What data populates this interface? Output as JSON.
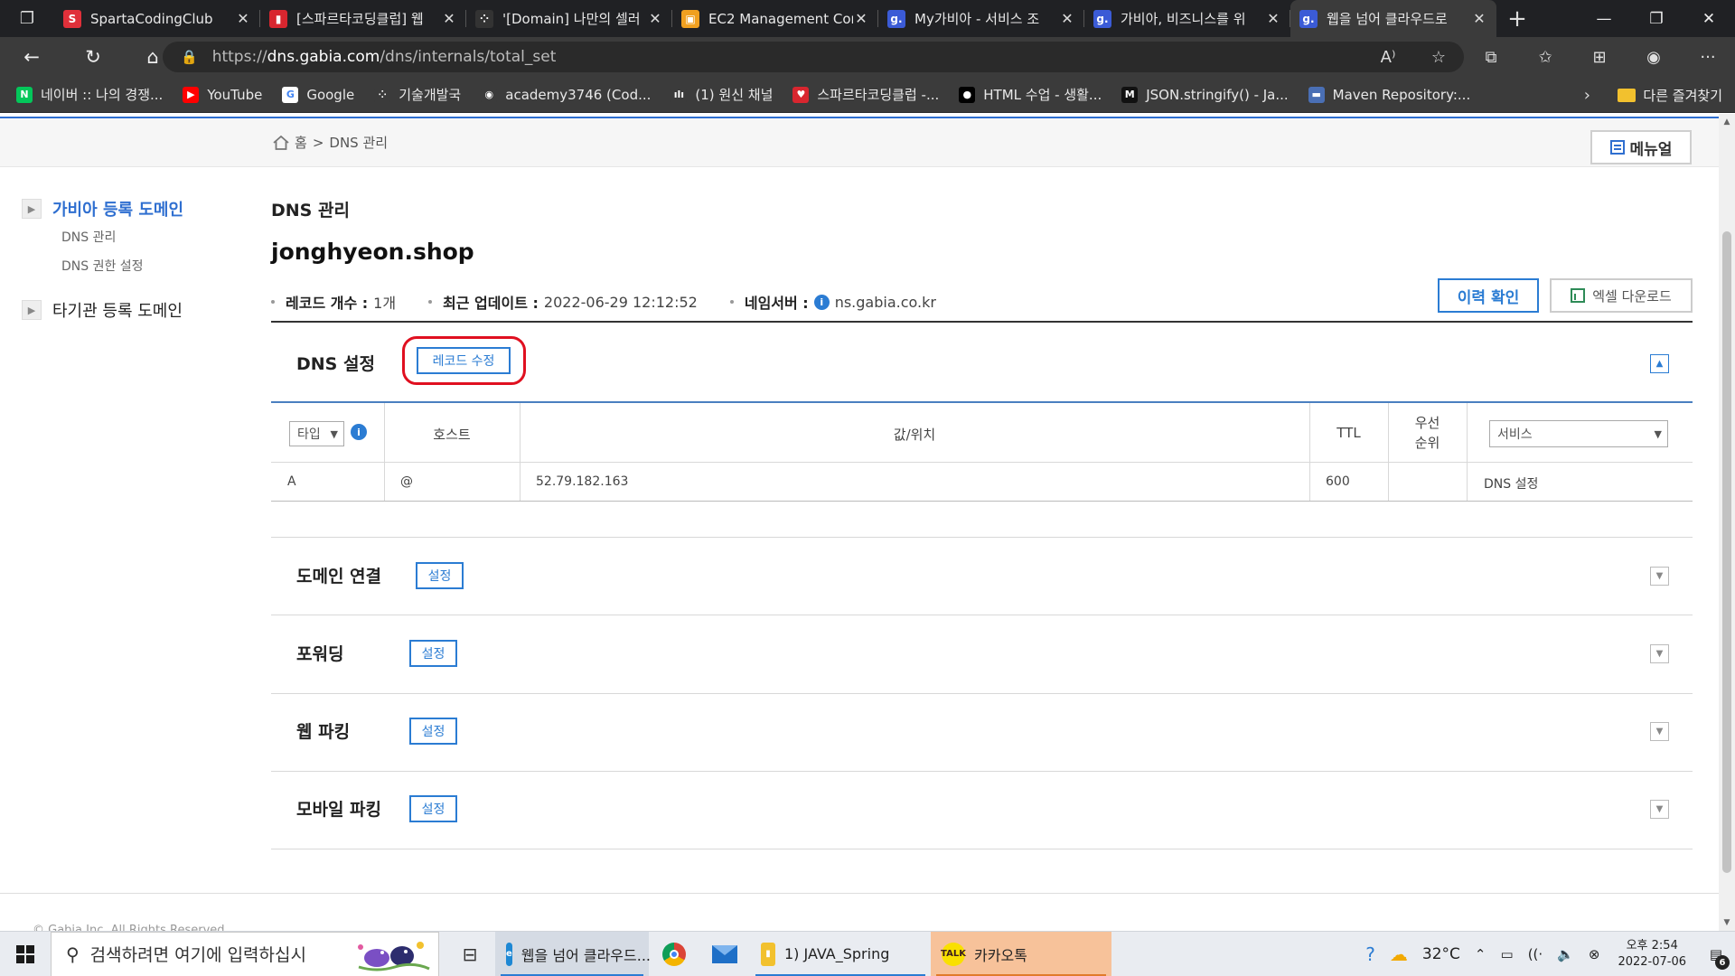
{
  "browser": {
    "tabs": [
      {
        "title": "SpartaCodingClub",
        "favicon_color": "#e0303a",
        "favicon_glyph": "S",
        "active": false
      },
      {
        "title": "[스파르타코딩클럽] 웹",
        "favicon_color": "#d8262f",
        "favicon_glyph": "▮",
        "active": false
      },
      {
        "title": "'[Domain] 나만의 셀러",
        "favicon_color": "#333333",
        "favicon_glyph": "⁘",
        "active": false
      },
      {
        "title": "EC2 Management Con",
        "favicon_color": "#f0a020",
        "favicon_glyph": "▣",
        "active": false
      },
      {
        "title": "My가비아 - 서비스 조",
        "favicon_color": "#3b5bd6",
        "favicon_glyph": "g.",
        "active": false
      },
      {
        "title": "가비아, 비즈니스를 위",
        "favicon_color": "#3b5bd6",
        "favicon_glyph": "g.",
        "active": false
      },
      {
        "title": "웹을 넘어 클라우드로",
        "favicon_color": "#3b5bd6",
        "favicon_glyph": "g.",
        "active": true
      }
    ],
    "url_prefix": "https://",
    "url_host": "dns.gabia.com",
    "url_path": "/dns/internals/total_set",
    "bookmarks": [
      {
        "label": "네이버 :: 나의 경쟁...",
        "color": "#03c75a",
        "glyph": "N"
      },
      {
        "label": "YouTube",
        "color": "#ff0000",
        "glyph": "▶"
      },
      {
        "label": "Google",
        "color": "#ffffff",
        "glyph": "G"
      },
      {
        "label": "기술개발국",
        "color": "#3b3b3b",
        "glyph": "⁘"
      },
      {
        "label": "academy3746 (Cod...",
        "color": "#3b3b3b",
        "glyph": "◉"
      },
      {
        "label": "(1) 원신 채널",
        "color": "#3b3b3b",
        "glyph": "ılı"
      },
      {
        "label": "스파르타코딩클럽 -...",
        "color": "#d8262f",
        "glyph": "♥"
      },
      {
        "label": "HTML 수업 - 생활...",
        "color": "#000000",
        "glyph": "●"
      },
      {
        "label": "JSON.stringify() - Ja...",
        "color": "#111111",
        "glyph": "M"
      },
      {
        "label": "Maven Repository:...",
        "color": "#4a6fb5",
        "glyph": "▬"
      }
    ],
    "other_bookmarks": "다른 즐겨찾기"
  },
  "page": {
    "breadcrumb_home": "홈",
    "breadcrumb_sep": ">",
    "breadcrumb_current": "DNS 관리",
    "manual_button": "메뉴얼",
    "sidebar": {
      "group1": "가비아 등록 도메인",
      "sub1": "DNS 관리",
      "sub2": "DNS 권한 설정",
      "group2": "타기관 등록 도메인"
    },
    "heading": "DNS 관리",
    "domain": "jonghyeon.shop",
    "meta": {
      "record_count_label": "레코드 개수 :",
      "record_count_value": "1개",
      "last_update_label": "최근 업데이트 :",
      "last_update_value": "2022-06-29 12:12:52",
      "nameserver_label": "네임서버 :",
      "nameserver_value": "ns.gabia.co.kr"
    },
    "history_button": "이력 확인",
    "excel_button": "엑셀 다운로드",
    "dns_section": {
      "title": "DNS 설정",
      "edit_button": "레코드 수정",
      "columns": {
        "type_select": "타입",
        "host": "호스트",
        "value": "값/위치",
        "ttl": "TTL",
        "priority_line1": "우선",
        "priority_line2": "순위",
        "service_select": "서비스"
      },
      "rows": [
        {
          "type": "A",
          "host": "@",
          "value": "52.79.182.163",
          "ttl": "600",
          "priority": "",
          "service": "DNS 설정"
        }
      ]
    },
    "sections": [
      {
        "title": "도메인 연결",
        "button": "설정"
      },
      {
        "title": "포워딩",
        "button": "설정"
      },
      {
        "title": "웹 파킹",
        "button": "설정"
      },
      {
        "title": "모바일 파킹",
        "button": "설정"
      }
    ],
    "copyright": "© Gabia Inc. All Rights Reserved."
  },
  "taskbar": {
    "search_placeholder": "검색하려면 여기에 입력하십시",
    "apps": [
      {
        "label": "웹을 넘어 클라우드...",
        "icon_color": "#1e88d4",
        "glyph": "e"
      },
      {
        "label": "1) JAVA_Spring",
        "icon_color": "#f2c12e",
        "glyph": "▮"
      },
      {
        "label": "카카오톡",
        "icon_color": "#3c1e1e",
        "glyph": "TALK"
      }
    ],
    "weather": "32°C",
    "time": "오후 2:54",
    "date": "2022-07-06",
    "notification_count": "6"
  }
}
